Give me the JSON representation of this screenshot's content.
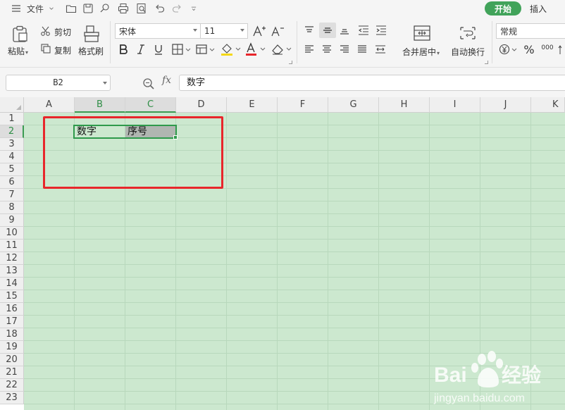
{
  "menu": {
    "file_label": "文件",
    "tab_start": "开始",
    "tab_insert": "插入"
  },
  "ribbon": {
    "paste_label": "粘贴",
    "cut_label": "剪切",
    "copy_label": "复制",
    "format_painter_label": "格式刷",
    "font_name": "宋体",
    "font_size": "11",
    "merge_center_label": "合并居中",
    "wrap_text_label": "自动换行",
    "number_format": "常规",
    "percent_symbol": "%",
    "thousands_symbol": "000"
  },
  "formula_bar": {
    "name_box": "B2",
    "fx_label": "fx",
    "content": "数字"
  },
  "grid": {
    "columns": [
      "A",
      "B",
      "C",
      "D",
      "E",
      "F",
      "G",
      "H",
      "I",
      "J",
      "K"
    ],
    "rows": [
      "1",
      "2",
      "3",
      "4",
      "5",
      "6",
      "7",
      "8",
      "9",
      "10",
      "11",
      "12",
      "13",
      "14",
      "15",
      "16",
      "17",
      "18",
      "19",
      "20",
      "21",
      "22",
      "23"
    ],
    "active_cell": "B2",
    "b2_value": "数字",
    "c2_value": "序号"
  },
  "colors": {
    "accent_green": "#41a35a",
    "cell_bg": "#cce8cf",
    "annotation_red": "#e8262b"
  },
  "watermark": {
    "brand_left": "Bai",
    "brand_right": "经验",
    "url": "jingyan.baidu.com"
  }
}
